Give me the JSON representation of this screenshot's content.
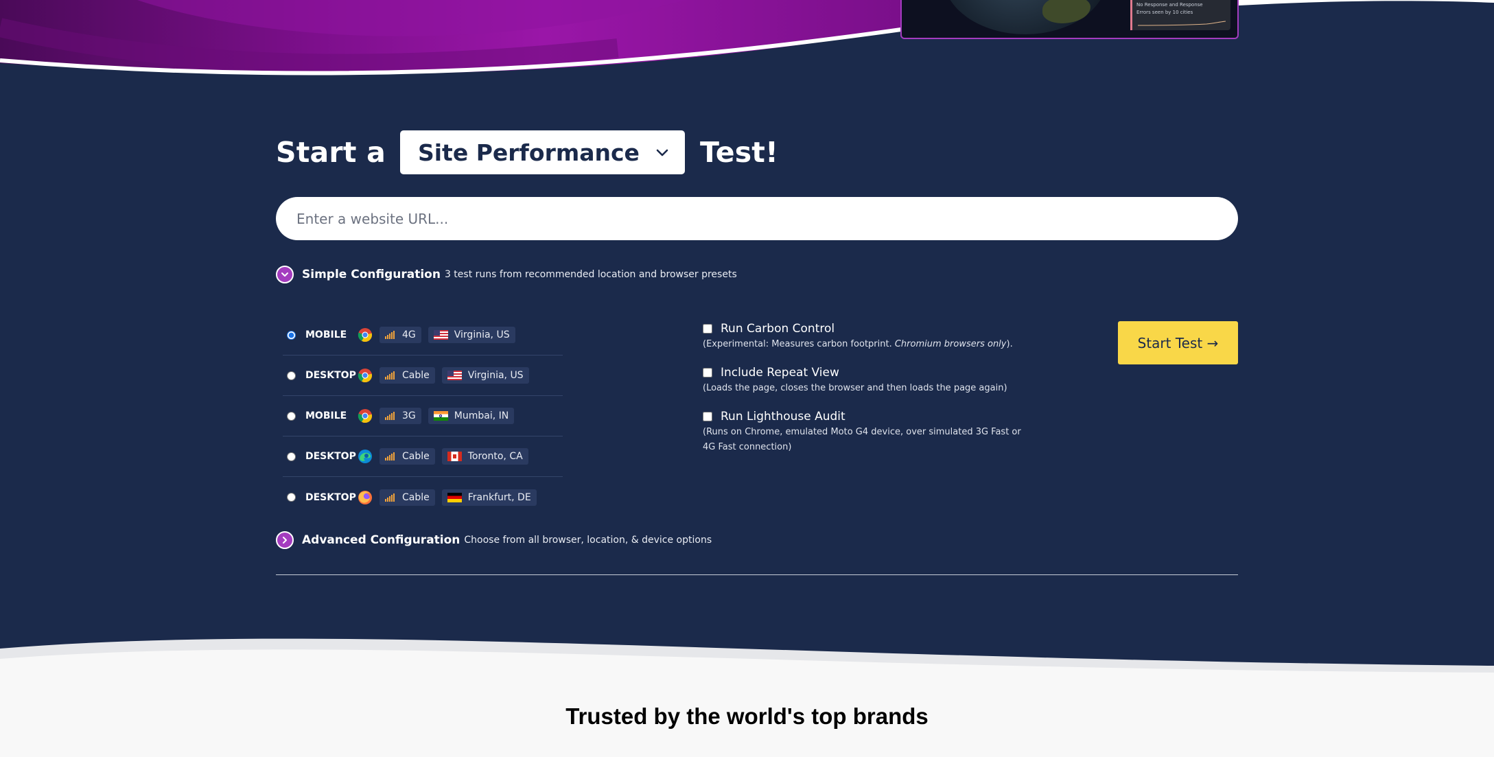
{
  "colors": {
    "navy": "#1b2a4b",
    "purple_accent": "#a43cbf",
    "button_yellow": "#f9d748",
    "signal_orange": "#f2a33a"
  },
  "preview_panel": {
    "line1": "No Response and Response",
    "line2": "Errors seen by 10 cities"
  },
  "start": {
    "prefix": "Start a",
    "selected_test": "Site Performance",
    "suffix": "Test!"
  },
  "url_input": {
    "placeholder": "Enter a website URL...",
    "value": ""
  },
  "simple_config": {
    "title": "Simple Configuration",
    "description": "3 test runs from recommended location and browser presets",
    "icon": "chevron-down-icon"
  },
  "presets": [
    {
      "device": "MOBILE",
      "browser": "chrome-icon",
      "connection": "4G",
      "location": "Virginia, US",
      "flag": "us-flag-icon",
      "selected": true
    },
    {
      "device": "DESKTOP",
      "browser": "chrome-icon",
      "connection": "Cable",
      "location": "Virginia, US",
      "flag": "us-flag-icon",
      "selected": false
    },
    {
      "device": "MOBILE",
      "browser": "chrome-icon",
      "connection": "3G",
      "location": "Mumbai, IN",
      "flag": "in-flag-icon",
      "selected": false
    },
    {
      "device": "DESKTOP",
      "browser": "edge-icon",
      "connection": "Cable",
      "location": "Toronto, CA",
      "flag": "ca-flag-icon",
      "selected": false
    },
    {
      "device": "DESKTOP",
      "browser": "firefox-icon",
      "connection": "Cable",
      "location": "Frankfurt, DE",
      "flag": "de-flag-icon",
      "selected": false
    }
  ],
  "options": {
    "carbon": {
      "label": "Run Carbon Control",
      "hint_prefix": "(Experimental: Measures carbon footprint. ",
      "hint_em": "Chromium browsers only",
      "hint_suffix": ").",
      "checked": false
    },
    "repeat": {
      "label": "Include Repeat View",
      "hint": "(Loads the page, closes the browser and then loads the page again)",
      "checked": false
    },
    "lighthouse": {
      "label": "Run Lighthouse Audit",
      "hint": "(Runs on Chrome, emulated Moto G4 device, over simulated 3G Fast or 4G Fast connection)",
      "checked": false
    }
  },
  "start_button": {
    "label": "Start Test →"
  },
  "advanced_config": {
    "title": "Advanced Configuration",
    "description": "Choose from all browser, location, & device options",
    "icon": "chevron-right-icon"
  },
  "brands_heading": "Trusted by the world's top brands"
}
